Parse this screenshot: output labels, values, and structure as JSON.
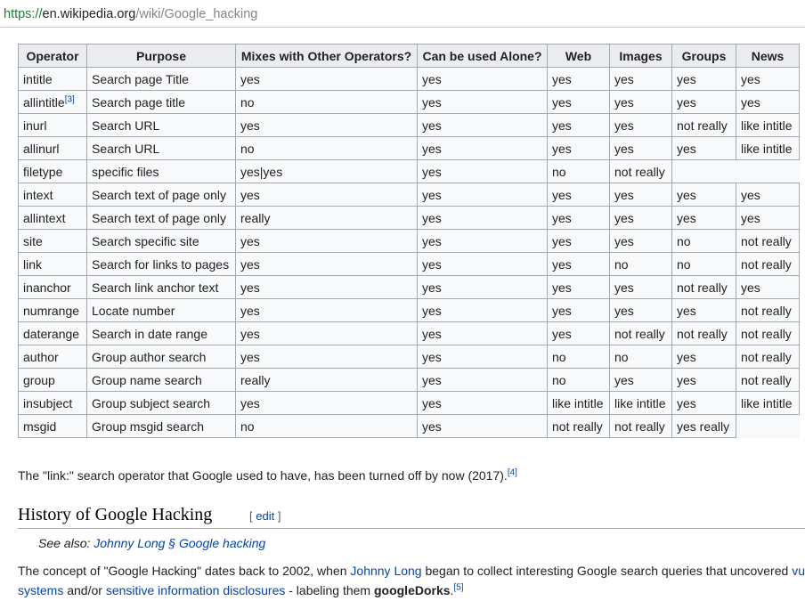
{
  "url": {
    "scheme": "https://",
    "host": "en.wikipedia.org",
    "path": "/wiki/Google_hacking"
  },
  "table": {
    "headers": [
      "Operator",
      "Purpose",
      "Mixes with Other Operators?",
      "Can be used Alone?",
      "Web",
      "Images",
      "Groups",
      "News"
    ],
    "rows": [
      [
        "intitle",
        "Search page Title",
        "yes",
        "yes",
        "yes",
        "yes",
        "yes",
        "yes"
      ],
      [
        "allintitle",
        "Search page title",
        "no",
        "yes",
        "yes",
        "yes",
        "yes",
        "yes"
      ],
      [
        "inurl",
        "Search URL",
        "yes",
        "yes",
        "yes",
        "yes",
        "not really",
        "like intitle"
      ],
      [
        "allinurl",
        "Search URL",
        "no",
        "yes",
        "yes",
        "yes",
        "yes",
        "like intitle"
      ],
      [
        "filetype",
        "specific files",
        "yes|yes",
        "yes",
        "no",
        "not really",
        "",
        ""
      ],
      [
        "intext",
        "Search text of page only",
        "yes",
        "yes",
        "yes",
        "yes",
        "yes",
        "yes"
      ],
      [
        "allintext",
        "Search text of page only",
        "really",
        "yes",
        "yes",
        "yes",
        "yes",
        "yes"
      ],
      [
        "site",
        "Search specific site",
        "yes",
        "yes",
        "yes",
        "yes",
        "no",
        "not really"
      ],
      [
        "link",
        "Search for links to pages",
        "yes",
        "yes",
        "yes",
        "no",
        "no",
        "not really"
      ],
      [
        "inanchor",
        "Search link anchor text",
        "yes",
        "yes",
        "yes",
        "yes",
        "not really",
        "yes"
      ],
      [
        "numrange",
        "Locate number",
        "yes",
        "yes",
        "yes",
        "yes",
        "yes",
        "not really"
      ],
      [
        "daterange",
        "Search in date range",
        "yes",
        "yes",
        "yes",
        "not really",
        "not really",
        "not really"
      ],
      [
        "author",
        "Group author search",
        "yes",
        "yes",
        "no",
        "no",
        "yes",
        "not really"
      ],
      [
        "group",
        "Group name search",
        "really",
        "yes",
        "no",
        "yes",
        "yes",
        "not really"
      ],
      [
        "insubject",
        "Group subject search",
        "yes",
        "yes",
        "like intitle",
        "like intitle",
        "yes",
        "like intitle"
      ],
      [
        "msgid",
        "Group msgid search",
        "no",
        "yes",
        "not really",
        "not really",
        "yes really",
        ""
      ]
    ],
    "allintitle_ref": "[3]"
  },
  "note": {
    "text": "The \"link:\" search operator that Google used to have, has been turned off by now (2017).",
    "ref": "[4]"
  },
  "section": {
    "title": "History of Google Hacking",
    "edit_open": "[ ",
    "edit_label": "edit",
    "edit_close": " ]"
  },
  "see_also": {
    "prefix": "See also: ",
    "link": "Johnny Long § Google hacking"
  },
  "paragraph": {
    "line1_a": "The concept of \"Google Hacking\" dates back to 2002, when ",
    "line1_link1": "Johnny Long",
    "line1_b": " began to collect interesting Google search queries that uncovered ",
    "line1_link2": "vu",
    "line2_link1": "systems",
    "line2_a": " and/or ",
    "line2_link2": "sensitive information disclosures",
    "line2_b": " - labeling them ",
    "line2_bold": "googleDorks",
    "line2_c": ".",
    "ref": "[5]"
  }
}
